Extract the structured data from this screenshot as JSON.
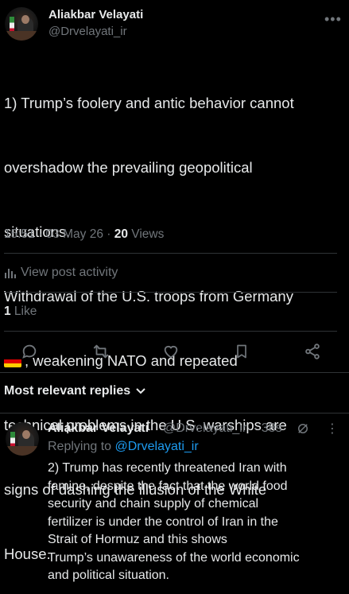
{
  "post": {
    "author_name": "Aliakbar Velayati",
    "author_handle": "@Drvelayati_ir",
    "more_label": "•••",
    "lines": [
      "1) Trump’s foolery and antic behavior cannot",
      "overshadow the prevailing geopolitical",
      "situations.",
      "Withdrawal of the U.S. troops from Germany",
      ", weakening NATO and repeated",
      "technical problems in the U.S. warships are",
      "signs of dashing the illusion of the White",
      "House."
    ],
    "flag_icon": "germany-flag-icon",
    "timestamp": "15:51 · 03 May 26 · ",
    "views_count": "20",
    "views_label": " Views",
    "view_activity": "View post activity",
    "likes_count": "1",
    "likes_label": " Like",
    "actions": [
      {
        "name": "reply-icon"
      },
      {
        "name": "repost-icon"
      },
      {
        "name": "like-icon"
      },
      {
        "name": "bookmark-icon"
      },
      {
        "name": "share-icon"
      }
    ]
  },
  "replies": {
    "sort_label": "Most relevant replies"
  },
  "reply": {
    "author_name": "Aliakbar Velayati",
    "author_handle": "@Drvelayati_ir",
    "time": "· 38s",
    "more_label": "⋮",
    "replying_prefix": "Replying to ",
    "replying_handle": "@Drvelayati_ir",
    "lines": [
      "2) Trump has recently threatened Iran with",
      "famine, despite the fact that the world food",
      "security and chain supply of chemical",
      "fertilizer is under the control of Iran in the",
      "Strait of Hormuz and this shows",
      "Trump’s unawareness of the world economic",
      "and political situation."
    ]
  },
  "colors": {
    "background": "#000000",
    "text": "#e7e9ea",
    "muted": "#71767b",
    "accent": "#1d9bf0",
    "divider": "#2f3336"
  }
}
